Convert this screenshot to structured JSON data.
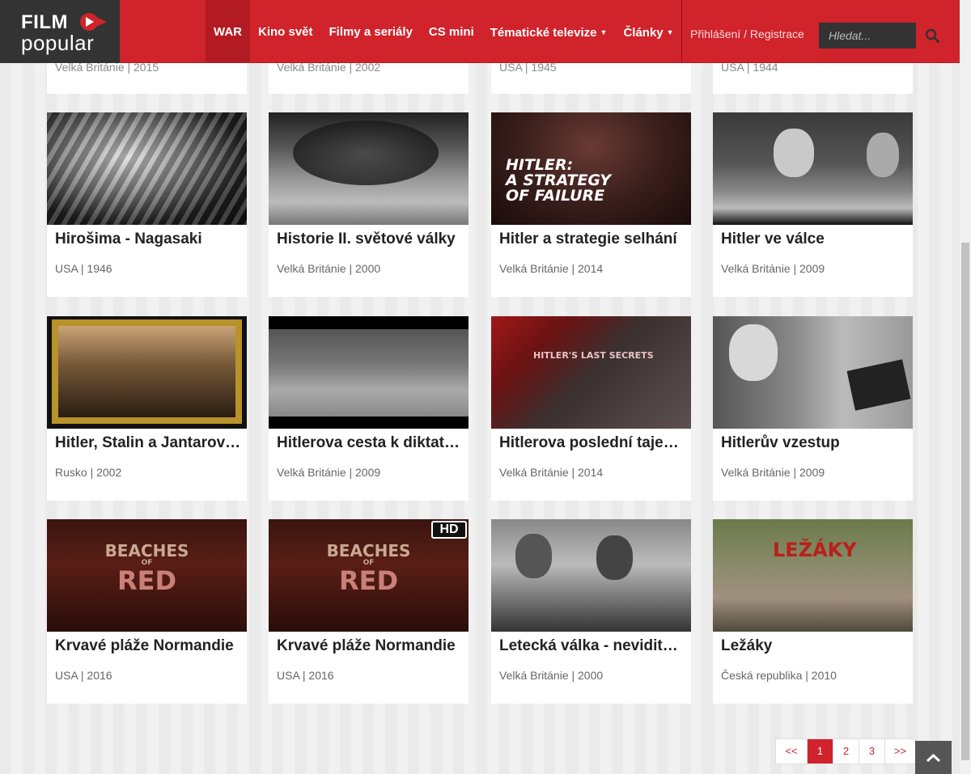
{
  "brand": {
    "line1": "FILM",
    "line2": "popular"
  },
  "nav": {
    "items": [
      {
        "label": "WAR"
      },
      {
        "label": "Kino svět"
      },
      {
        "label": "Filmy a seriály"
      },
      {
        "label": "CS mini"
      },
      {
        "label": "Tématické televize"
      },
      {
        "label": "Články"
      }
    ],
    "login": "Přihlášení / Registrace",
    "search_placeholder": "Hledat..."
  },
  "top_row": [
    {
      "meta": "Velká Británie | 2015"
    },
    {
      "meta": "Velká Británie | 2002"
    },
    {
      "meta": "USA | 1945"
    },
    {
      "meta": "USA | 1944"
    }
  ],
  "cards": [
    {
      "title": "Hirošima - Nagasaki",
      "meta": "USA | 1946"
    },
    {
      "title": "Historie II. světové války",
      "meta": "Velká Británie | 2000"
    },
    {
      "title": "Hitler a strategie selhání",
      "meta": "Velká Británie | 2014",
      "thumb_text": [
        "HITLER:",
        "A STRATEGY",
        "OF FAILURE"
      ]
    },
    {
      "title": "Hitler ve válce",
      "meta": "Velká Británie | 2009"
    },
    {
      "title": "Hitler, Stalin a Jantarová komnata",
      "meta": "Rusko | 2002"
    },
    {
      "title": "Hitlerova cesta k diktatuře",
      "meta": "Velká Británie | 2009"
    },
    {
      "title": "Hitlerova poslední tajemství",
      "meta": "Velká Británie | 2014",
      "thumb_text": "HITLER'S LAST SECRETS"
    },
    {
      "title": "Hitlerův vzestup",
      "meta": "Velká Británie | 2009"
    },
    {
      "title": "Krvavé pláže Normandie",
      "meta": "USA | 2016",
      "thumb_text": [
        "BEACHES",
        "OF",
        "RED"
      ]
    },
    {
      "title": "Krvavé pláže Normandie",
      "meta": "USA | 2016",
      "thumb_text": [
        "BEACHES",
        "OF",
        "RED"
      ],
      "badge": "HD"
    },
    {
      "title": "Letecká válka - neviditelná",
      "meta": "Velká Británie | 2000"
    },
    {
      "title": "Ležáky",
      "meta": "Česká republika | 2010",
      "thumb_text": "LEŽÁKY"
    }
  ],
  "pagination": {
    "prev": "<<",
    "pages": [
      "1",
      "2",
      "3"
    ],
    "next": ">>",
    "current": "1"
  }
}
